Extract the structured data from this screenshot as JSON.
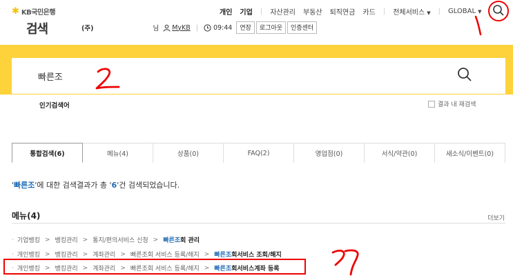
{
  "header": {
    "logo_text": "KB국민은행",
    "page_title": "검색",
    "company": "(주)",
    "nim": "님",
    "mykb": "MyKB",
    "time": "09:44",
    "buttons": [
      "연장",
      "로그아웃",
      "인증센터"
    ]
  },
  "topnav": {
    "items": [
      {
        "label": "개인",
        "bold": true
      },
      {
        "label": "기업",
        "bold": true
      },
      {
        "label": "자산관리"
      },
      {
        "label": "부동산"
      },
      {
        "label": "퇴직연금"
      },
      {
        "label": "카드"
      },
      {
        "label": "전체서비스"
      },
      {
        "label": "GLOBAL"
      }
    ]
  },
  "search": {
    "value": "빠른조",
    "popular_label": "인기검색어",
    "in_result_label": "결과 내 재검색"
  },
  "tabs": [
    {
      "label": "통합검색(6)",
      "active": true
    },
    {
      "label": "메뉴(4)"
    },
    {
      "label": "상품(0)"
    },
    {
      "label": "FAQ(2)"
    },
    {
      "label": "영업점(0)"
    },
    {
      "label": "서식/약관(0)"
    },
    {
      "label": "새소식/이벤트(0)"
    }
  ],
  "result": {
    "q_open": "'",
    "keyword": "빠른조",
    "mid": "'에 대한 검색결과가 총 '",
    "count": "6",
    "tail": "'건 검색되었습니다."
  },
  "menu_section": {
    "heading": "메뉴(4)",
    "more": "더보기",
    "rows": [
      {
        "path": [
          "기업뱅킹",
          "뱅킹관리",
          "통지/편의서비스 신청"
        ],
        "hl": "빠른조",
        "rest": "회 관리"
      },
      {
        "path": [
          "개인뱅킹",
          "뱅킹관리",
          "계좌관리",
          "빠른조회 서비스 등록/해지"
        ],
        "hl": "빠른조",
        "rest": "회서비스 조회/해지"
      },
      {
        "path": [
          "개인뱅킹",
          "뱅킹관리",
          "계좌관리",
          "빠른조회 서비스 등록/해지"
        ],
        "hl": "빠른조",
        "rest": "회서비스계좌 등록"
      }
    ]
  },
  "colors": {
    "accent_yellow": "#fdd23a",
    "link_blue": "#1f6bb5",
    "annotation_red": "#e00000"
  }
}
